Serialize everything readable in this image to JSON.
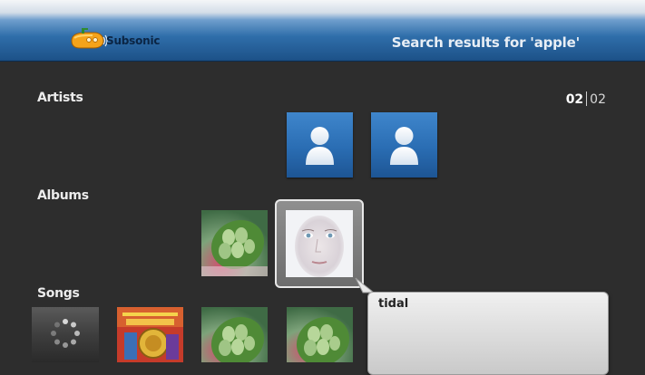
{
  "app": {
    "logo_text": "Subsonic"
  },
  "header": {
    "title": "Search results for 'apple'"
  },
  "pager": {
    "current": "02",
    "total": "02"
  },
  "sections": {
    "artists": "Artists",
    "albums": "Albums",
    "songs": "Songs"
  },
  "tooltip": {
    "text": "tidal"
  },
  "colors": {
    "header_blue": "#1d5289",
    "tile_blue": "#2a6db3",
    "background": "#2d2d2d"
  },
  "icons": {
    "artist_placeholder": "person-icon",
    "loading": "spinner-icon"
  }
}
